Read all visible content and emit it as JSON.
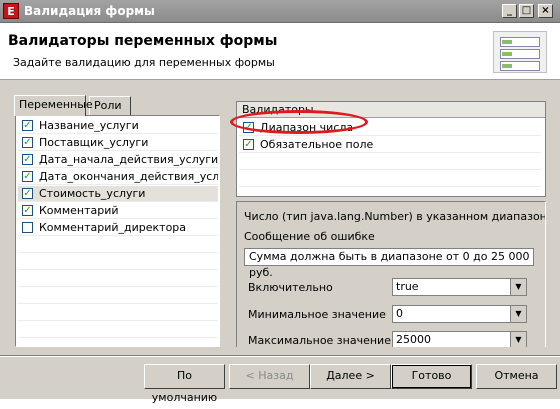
{
  "window": {
    "title": "Валидация формы",
    "app_icon_glyph": "E"
  },
  "header": {
    "title": "Валидаторы переменных формы",
    "subtitle": "Задайте валидацию для переменных формы"
  },
  "left_tabs": [
    "Переменные",
    "Роли"
  ],
  "variables": [
    {
      "label": "Название_услуги",
      "checked": true
    },
    {
      "label": "Поставщик_услуги",
      "checked": true
    },
    {
      "label": "Дата_начала_действия_услуги",
      "checked": true
    },
    {
      "label": "Дата_окончания_действия_услу...",
      "checked": true
    },
    {
      "label": "Стоимость_услуги",
      "checked": true,
      "selected": true
    },
    {
      "label": "Комментарий",
      "checked": true
    },
    {
      "label": "Комментарий_директора",
      "checked": false
    }
  ],
  "validators": {
    "header": "Валидаторы",
    "items": [
      {
        "label": "Диапазон числа",
        "checked": true
      },
      {
        "label": "Обязательное поле",
        "checked": true
      }
    ]
  },
  "details": {
    "description": "Число (тип java.lang.Number) в указанном диапазоне. Мо",
    "error_label": "Сообщение об ошибке",
    "error_value": "Сумма должна быть в диапазоне от 0 до 25 000 руб.",
    "fields": [
      {
        "label": "Включительно",
        "value": "true"
      },
      {
        "label": "Минимальное значение",
        "value": "0"
      },
      {
        "label": "Максимальное значение",
        "value": "25000"
      }
    ]
  },
  "buttons": {
    "default": "По умолчанию",
    "back": "< Назад",
    "next": "Далее >",
    "done": "Готово",
    "cancel": "Отмена"
  },
  "annotation_color": "#e0191e"
}
